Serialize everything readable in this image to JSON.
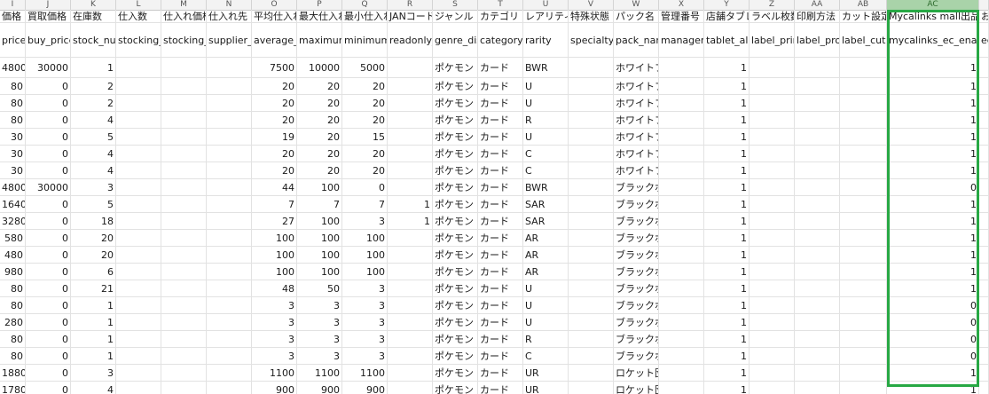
{
  "colors": {
    "highlight": "#27a844",
    "selected_col_header": "#a9d3a9"
  },
  "column_letters": [
    "I",
    "J",
    "K",
    "L",
    "M",
    "N",
    "O",
    "P",
    "Q",
    "R",
    "S",
    "T",
    "U",
    "V",
    "W",
    "X",
    "Y",
    "Z",
    "AA",
    "AB",
    "AC",
    ""
  ],
  "header_ja": [
    "価格",
    "買取価格",
    "在庫数",
    "仕入数",
    "仕入れ価格",
    "仕入れ先",
    "平均仕入れ",
    "最大仕入れ",
    "最小仕入れ",
    "JANコード",
    "ジャンル",
    "カテゴリ",
    "レアリティ",
    "特殊状態",
    "パック名",
    "管理番号",
    "店舗タブレ",
    "ラベル枚数",
    "印刷方法",
    "カット設定",
    "Mycalinks mall出品",
    "お"
  ],
  "header_en": [
    "price",
    "buy_price",
    "stock_num",
    "stocking_i",
    "stocking_v",
    "supplier_c",
    "average_w",
    "maximum_",
    "minimum_",
    "readonly_p",
    "genre_disp",
    "category_d",
    "rarity",
    "specialty_",
    "pack_nam",
    "manageme",
    "tablet_allo",
    "label_prin",
    "label_proc",
    "label_cut",
    "mycalinks_ec_enabl",
    "ec"
  ],
  "rows": [
    [
      "4800",
      "30000",
      "1",
      "",
      "",
      "",
      "7500",
      "10000",
      "5000",
      "",
      "ポケモン",
      "カード",
      "BWR",
      "",
      "ホワイトフレア",
      "",
      "1",
      "",
      "",
      "",
      "1",
      ""
    ],
    [
      "80",
      "0",
      "2",
      "",
      "",
      "",
      "20",
      "20",
      "20",
      "",
      "ポケモン",
      "カード",
      "U",
      "",
      "ホワイトフレア",
      "",
      "1",
      "",
      "",
      "",
      "1",
      ""
    ],
    [
      "80",
      "0",
      "2",
      "",
      "",
      "",
      "20",
      "20",
      "20",
      "",
      "ポケモン",
      "カード",
      "U",
      "",
      "ホワイトフレア",
      "",
      "1",
      "",
      "",
      "",
      "1",
      ""
    ],
    [
      "80",
      "0",
      "4",
      "",
      "",
      "",
      "20",
      "20",
      "20",
      "",
      "ポケモン",
      "カード",
      "R",
      "",
      "ホワイトフレア",
      "",
      "1",
      "",
      "",
      "",
      "1",
      ""
    ],
    [
      "30",
      "0",
      "5",
      "",
      "",
      "",
      "19",
      "20",
      "15",
      "",
      "ポケモン",
      "カード",
      "U",
      "",
      "ホワイトフレア",
      "",
      "1",
      "",
      "",
      "",
      "1",
      ""
    ],
    [
      "30",
      "0",
      "4",
      "",
      "",
      "",
      "20",
      "20",
      "20",
      "",
      "ポケモン",
      "カード",
      "C",
      "",
      "ホワイトフレア",
      "",
      "1",
      "",
      "",
      "",
      "1",
      ""
    ],
    [
      "30",
      "0",
      "4",
      "",
      "",
      "",
      "20",
      "20",
      "20",
      "",
      "ポケモン",
      "カード",
      "C",
      "",
      "ホワイトフレア",
      "",
      "1",
      "",
      "",
      "",
      "1",
      ""
    ],
    [
      "4800",
      "30000",
      "3",
      "",
      "",
      "",
      "44",
      "100",
      "0",
      "",
      "ポケモン",
      "カード",
      "BWR",
      "",
      "ブラックボルト",
      "",
      "1",
      "",
      "",
      "",
      "0",
      ""
    ],
    [
      "1640",
      "0",
      "5",
      "",
      "",
      "",
      "7",
      "7",
      "7",
      "1",
      "ポケモン",
      "カード",
      "SAR",
      "",
      "ブラックボルト",
      "",
      "1",
      "",
      "",
      "",
      "1",
      ""
    ],
    [
      "3280",
      "0",
      "18",
      "",
      "",
      "",
      "27",
      "100",
      "3",
      "1",
      "ポケモン",
      "カード",
      "SAR",
      "",
      "ブラックボルト",
      "",
      "1",
      "",
      "",
      "",
      "1",
      ""
    ],
    [
      "580",
      "0",
      "20",
      "",
      "",
      "",
      "100",
      "100",
      "100",
      "",
      "ポケモン",
      "カード",
      "AR",
      "",
      "ブラックボルト",
      "",
      "1",
      "",
      "",
      "",
      "1",
      ""
    ],
    [
      "480",
      "0",
      "20",
      "",
      "",
      "",
      "100",
      "100",
      "100",
      "",
      "ポケモン",
      "カード",
      "AR",
      "",
      "ブラックボルト",
      "",
      "1",
      "",
      "",
      "",
      "1",
      ""
    ],
    [
      "980",
      "0",
      "6",
      "",
      "",
      "",
      "100",
      "100",
      "100",
      "",
      "ポケモン",
      "カード",
      "AR",
      "",
      "ブラックボルト",
      "",
      "1",
      "",
      "",
      "",
      "1",
      ""
    ],
    [
      "80",
      "0",
      "21",
      "",
      "",
      "",
      "48",
      "50",
      "3",
      "",
      "ポケモン",
      "カード",
      "U",
      "",
      "ブラックボルト",
      "",
      "1",
      "",
      "",
      "",
      "1",
      ""
    ],
    [
      "80",
      "0",
      "1",
      "",
      "",
      "",
      "3",
      "3",
      "3",
      "",
      "ポケモン",
      "カード",
      "U",
      "",
      "ブラックボルト",
      "",
      "1",
      "",
      "",
      "",
      "0",
      ""
    ],
    [
      "280",
      "0",
      "1",
      "",
      "",
      "",
      "3",
      "3",
      "3",
      "",
      "ポケモン",
      "カード",
      "U",
      "",
      "ブラックボルト",
      "",
      "1",
      "",
      "",
      "",
      "0",
      ""
    ],
    [
      "80",
      "0",
      "1",
      "",
      "",
      "",
      "3",
      "3",
      "3",
      "",
      "ポケモン",
      "カード",
      "R",
      "",
      "ブラックボルト",
      "",
      "1",
      "",
      "",
      "",
      "0",
      ""
    ],
    [
      "80",
      "0",
      "1",
      "",
      "",
      "",
      "3",
      "3",
      "3",
      "",
      "ポケモン",
      "カード",
      "C",
      "",
      "ブラックボルト",
      "",
      "1",
      "",
      "",
      "",
      "0",
      ""
    ],
    [
      "1880",
      "0",
      "3",
      "",
      "",
      "",
      "1100",
      "1100",
      "1100",
      "",
      "ポケモン",
      "カード",
      "UR",
      "",
      "ロケット団の栄光",
      "",
      "1",
      "",
      "",
      "",
      "1",
      ""
    ],
    [
      "1780",
      "0",
      "4",
      "",
      "",
      "",
      "900",
      "900",
      "900",
      "",
      "ポケモン",
      "カード",
      "UR",
      "",
      "ロケット団の栄光",
      "",
      "1",
      "",
      "",
      "",
      "1",
      ""
    ]
  ]
}
